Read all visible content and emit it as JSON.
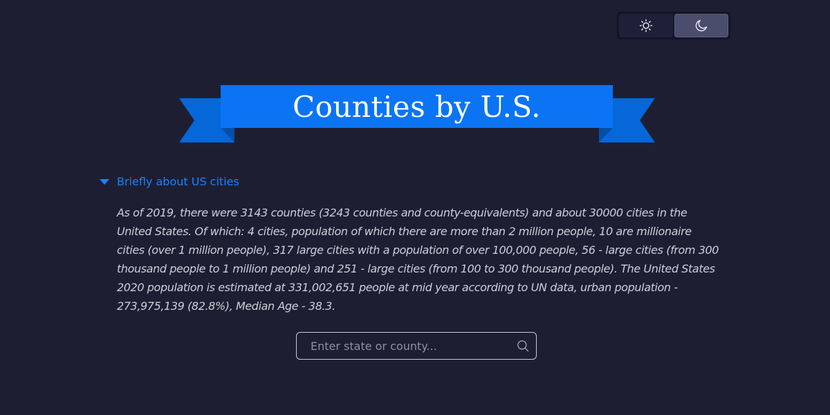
{
  "theme_toggle": {
    "options": [
      {
        "icon": "sun-icon",
        "selected": false
      },
      {
        "icon": "moon-icon",
        "selected": true
      }
    ]
  },
  "banner": {
    "title": "Counties by U.S."
  },
  "about": {
    "summary_label": "Briefly about US cities",
    "expanded": true,
    "body": "As of 2019, there were 3143 counties (3243 counties and county-equivalents) and about 30000 cities in the United States. Of which: 4 cities, population of which there are more than 2 million people, 10 are millionaire cities (over 1 million people), 317 large cities with a population of over 100,000 people, 56 - large cities (from 300 thousand people to 1 million people) and 251 - large cities (from 100 to 300 thousand people). The United States 2020 population is estimated at 331,002,651 people at mid year according to UN data, urban population - 273,975,139 (82.8%), Median Age - 38.3."
  },
  "search": {
    "placeholder": "Enter state or county...",
    "value": "",
    "icon": "search-icon"
  },
  "colors": {
    "background": "#1e1e33",
    "accent": "#1a82ff",
    "ribbon_front": "#0a74f5",
    "ribbon_back": "#0567d8",
    "toggle_selected": "#4b4d6c"
  }
}
